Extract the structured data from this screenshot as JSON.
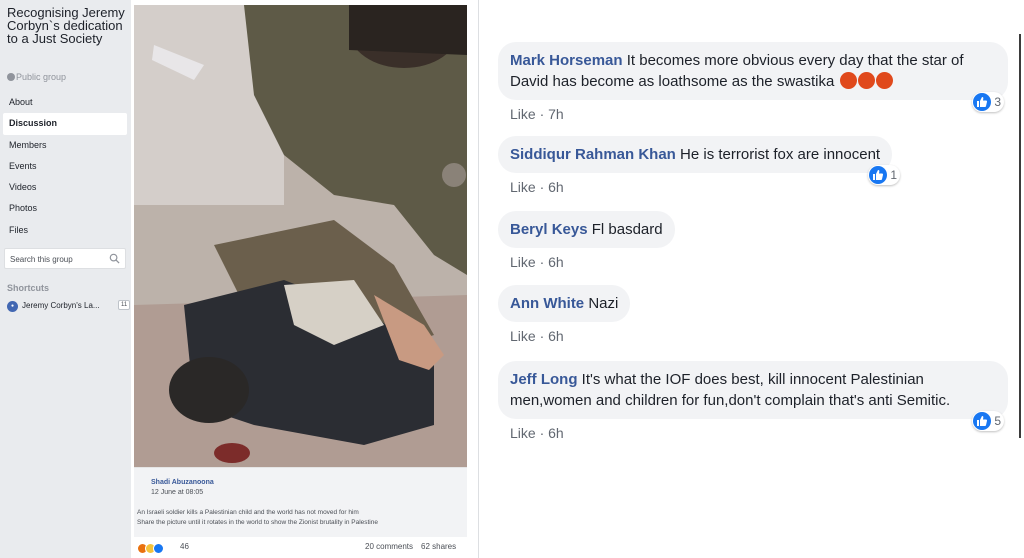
{
  "sidebar": {
    "group_title": "Recognising Jeremy Corbyn`s dedication to a Just Society",
    "group_type": "Public group",
    "nav": [
      "About",
      "Discussion",
      "Members",
      "Events",
      "Videos",
      "Photos",
      "Files"
    ],
    "active_nav": "Discussion",
    "search_placeholder": "Search this group",
    "shortcuts_heading": "Shortcuts",
    "shortcut": {
      "label": "Jeremy Corbyn's La...",
      "count": "11"
    }
  },
  "post": {
    "caption": {
      "author": "Shadi Abuzanoona",
      "date": "12 June at 08:05",
      "line1": "An Israeli soldier kills a Palestinian child and the world has not moved for him",
      "line2": "Share the picture until it rotates in the world to show the Zionist brutality in Palestine"
    },
    "reactions_count": "46",
    "comments_count": "20 comments",
    "shares_count": "62 shares"
  },
  "comments": [
    {
      "author": "Mark Horseman",
      "text": "It becomes more obvious every day that the star of David has become as loathsome as the swastika",
      "like_label": "Like",
      "time": "7h",
      "reactions": "3"
    },
    {
      "author": "Siddiqur Rahman Khan",
      "text": "He is terrorist fox are innocent",
      "like_label": "Like",
      "time": "6h",
      "reactions": "1"
    },
    {
      "author": "Beryl Keys",
      "text": "Fl basdard",
      "like_label": "Like",
      "time": "6h",
      "reactions": ""
    },
    {
      "author": "Ann White",
      "text": "Nazi",
      "like_label": "Like",
      "time": "6h",
      "reactions": ""
    },
    {
      "author": "Jeff Long",
      "text": "It's what the IOF does best, kill innocent Palestinian men,women and children for fun,don't complain that's anti Semitic.",
      "like_label": "Like",
      "time": "6h",
      "reactions": "5"
    }
  ],
  "colors": {
    "link_blue": "#385898",
    "bubble_bg": "#f2f3f5",
    "like_blue": "#1877f2",
    "sidebar_bg": "#e9ebee"
  }
}
